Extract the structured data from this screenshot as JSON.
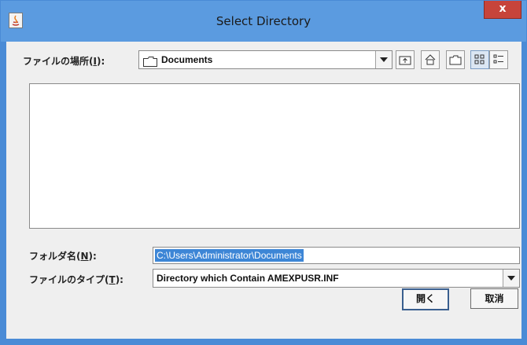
{
  "window": {
    "title": "Select Directory",
    "close_label": "x",
    "accent_color": "#5b9be0"
  },
  "look_in": {
    "label_prefix": "ファイルの場所(",
    "label_mnemonic": "I",
    "label_suffix": "):",
    "folder_icon": "folder-icon",
    "value": "Documents"
  },
  "toolbar": {
    "up_icon": "up-one-level-icon",
    "home_icon": "home-icon",
    "new_folder_icon": "new-folder-icon",
    "list_view_icon": "list-view-icon",
    "details_view_icon": "details-view-icon"
  },
  "folder_name": {
    "label_prefix": "フォルダ名(",
    "label_mnemonic": "N",
    "label_suffix": "):",
    "value": "C:\\Users\\Administrator\\Documents"
  },
  "file_type": {
    "label_prefix": "ファイルのタイプ(",
    "label_mnemonic": "T",
    "label_suffix": "):",
    "value": "Directory which Contain AMEXPUSR.INF"
  },
  "buttons": {
    "open_label": "開く",
    "cancel_label": "取消"
  }
}
